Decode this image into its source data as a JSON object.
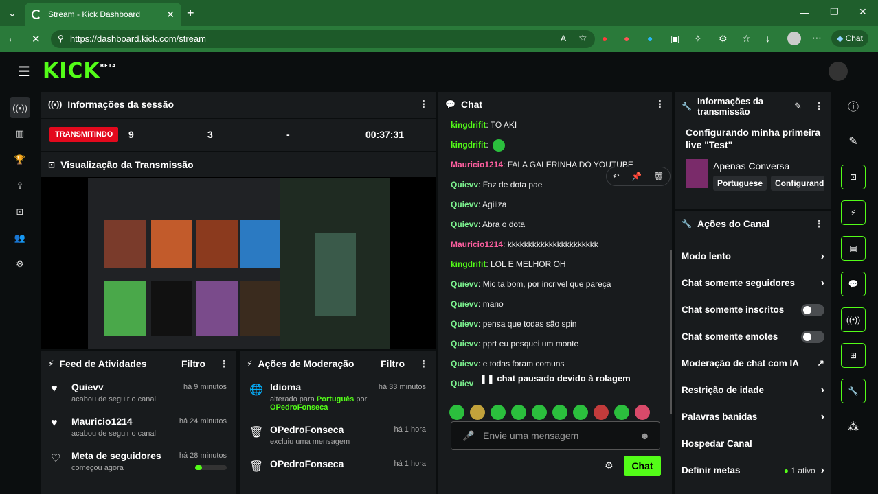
{
  "browser": {
    "tab_title": "Stream - Kick Dashboard",
    "url": "https://dashboard.kick.com/stream",
    "chat_button": "Chat"
  },
  "app": {
    "logo": "KICK",
    "logo_badge": "BETA"
  },
  "session": {
    "title": "Informações da sessão",
    "live_label": "TRANSMITINDO",
    "viewers": "9",
    "followers": "3",
    "other": "-",
    "duration": "00:37:31"
  },
  "preview": {
    "title": "Visualização da Transmissão"
  },
  "feed": {
    "title": "Feed de Atividades",
    "filter": "Filtro",
    "items": [
      {
        "name": "Quievv",
        "sub": "acabou de seguir o canal",
        "time": "há 9 minutos"
      },
      {
        "name": "Mauricio1214",
        "sub": "acabou de seguir o canal",
        "time": "há 24 minutos"
      },
      {
        "name": "Meta de seguidores",
        "sub": "começou agora",
        "time": "há 28 minutos"
      }
    ]
  },
  "moderation": {
    "title": "Ações de Moderação",
    "filter": "Filtro",
    "items": [
      {
        "name": "Idioma",
        "time": "há 33 minutos",
        "sub1": "alterado para ",
        "lang": "Português",
        "sub2": " por ",
        "by": "OPedroFonseca"
      },
      {
        "name": "OPedroFonseca",
        "time": "há 1 hora",
        "sub1": "excluiu uma mensagem"
      },
      {
        "name": "OPedroFonseca",
        "time": "há 1 hora",
        "sub1": ""
      }
    ]
  },
  "chat": {
    "title": "Chat",
    "messages": [
      {
        "user": "kingdrifit",
        "color": "green",
        "text": ": TO AKI"
      },
      {
        "user": "kingdrifit",
        "color": "green",
        "text": ":"
      },
      {
        "user": "Mauricio1214",
        "color": "pink",
        "text": ": FALA GALERINHA DO YOUTUBE"
      },
      {
        "user": "Quievv",
        "color": "aqua",
        "text": ": Faz de dota pae"
      },
      {
        "user": "Quievv",
        "color": "aqua",
        "text": ": Agiliza"
      },
      {
        "user": "Quievv",
        "color": "aqua",
        "text": ": Abra o dota"
      },
      {
        "user": "Mauricio1214",
        "color": "pink",
        "text": ": kkkkkkkkkkkkkkkkkkkkkk"
      },
      {
        "user": "kingdrifit",
        "color": "green",
        "text": ": LOL E MELHOR OH"
      },
      {
        "user": "Quievv",
        "color": "aqua",
        "text": ": Mic ta bom, por incrivel que pareça"
      },
      {
        "user": "Quievv",
        "color": "aqua",
        "text": ": mano"
      },
      {
        "user": "Quievv",
        "color": "aqua",
        "text": ": pensa que todas são spin"
      },
      {
        "user": "Quievv",
        "color": "aqua",
        "text": ": pprt eu pesquei um monte"
      },
      {
        "user": "Quievv",
        "color": "aqua",
        "text": ": e todas foram comuns"
      },
      {
        "user": "Quiev",
        "color": "aqua",
        "text": ""
      }
    ],
    "paused": "chat pausado devido à rolagem",
    "placeholder": "Envie uma mensagem",
    "send": "Chat"
  },
  "stream_info": {
    "title": "Informações da transmissão",
    "stream_title": "Configurando minha primeira live \"Test\"",
    "category": "Apenas Conversa",
    "tags": [
      "Portuguese",
      "Configurand"
    ]
  },
  "channel_actions": {
    "title": "Ações do Canal",
    "items": [
      {
        "label": "Modo lento",
        "kind": "chev"
      },
      {
        "label": "Chat somente seguidores",
        "kind": "chev"
      },
      {
        "label": "Chat somente inscritos",
        "kind": "toggle"
      },
      {
        "label": "Chat somente emotes",
        "kind": "toggle"
      },
      {
        "label": "Moderação de chat com IA",
        "kind": "ext"
      },
      {
        "label": "Restrição de idade",
        "kind": "chev"
      },
      {
        "label": "Palavras banidas",
        "kind": "chev"
      },
      {
        "label": "Hospedar Canal",
        "kind": "none"
      },
      {
        "label": "Definir metas",
        "kind": "chev",
        "extra": "1 ativo"
      }
    ]
  }
}
